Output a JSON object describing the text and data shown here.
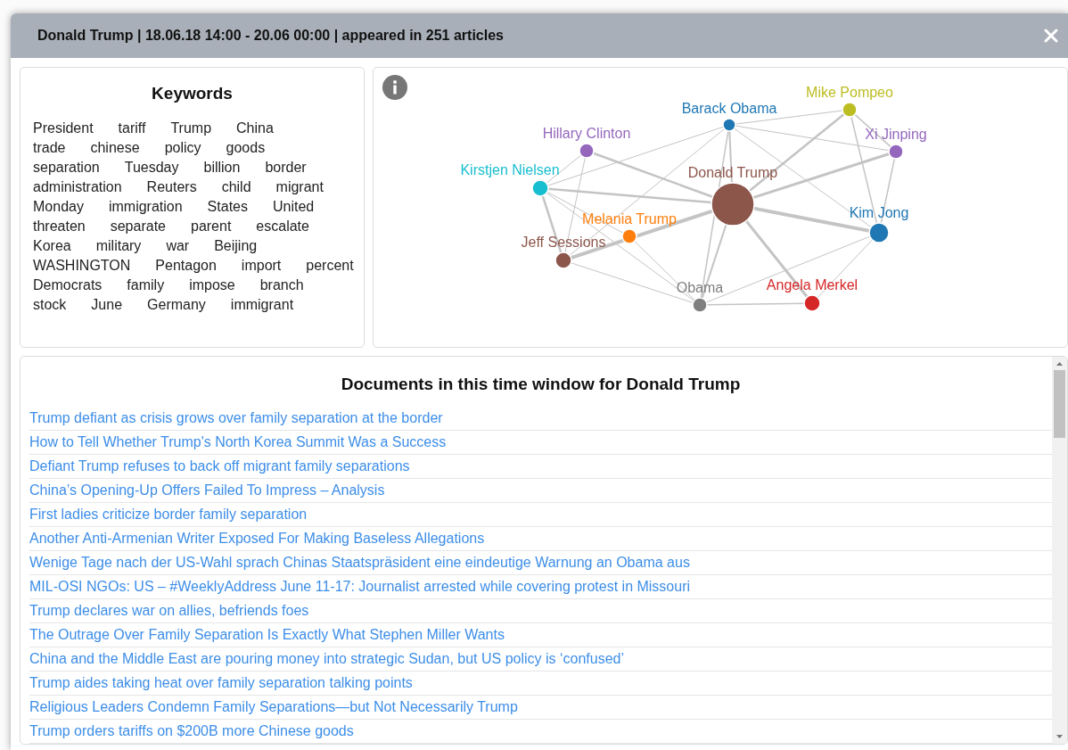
{
  "dialog": {
    "title": "Donald Trump | 18.06.18 14:00 - 20.06 00:00 | appeared in 251 articles"
  },
  "keywords": {
    "title": "Keywords",
    "words": [
      "President",
      "tariff",
      "Trump",
      "China",
      "trade",
      "chinese",
      "policy",
      "goods",
      "separation",
      "Tuesday",
      "billion",
      "border",
      "administration",
      "Reuters",
      "child",
      "migrant",
      "Monday",
      "immigration",
      "States",
      "United",
      "threaten",
      "separate",
      "parent",
      "escalate",
      "Korea",
      "military",
      "war",
      "Beijing",
      "WASHINGTON",
      "Pentagon",
      "import",
      "percent",
      "Democrats",
      "family",
      "impose",
      "branch",
      "stock",
      "June",
      "Germany",
      "immigrant"
    ]
  },
  "network": {
    "nodes": [
      {
        "name": "Barack Obama",
        "color": "#1f77b4"
      },
      {
        "name": "Mike Pompeo",
        "color": "#bcbd22"
      },
      {
        "name": "Hillary Clinton",
        "color": "#9467bd"
      },
      {
        "name": "Xi Jinping",
        "color": "#9467bd"
      },
      {
        "name": "Kirstjen Nielsen",
        "color": "#17becf"
      },
      {
        "name": "Donald Trump",
        "color": "#8c564b"
      },
      {
        "name": "Melania Trump",
        "color": "#ff7f0e"
      },
      {
        "name": "Kim Jong",
        "color": "#1f77b4"
      },
      {
        "name": "Jeff Sessions",
        "color": "#8c564b"
      },
      {
        "name": "Obama",
        "color": "#7f7f7f"
      },
      {
        "name": "Angela Merkel",
        "color": "#d62728"
      }
    ]
  },
  "documents": {
    "title": "Documents in this time window for Donald Trump",
    "items": [
      "Trump defiant as crisis grows over family separation at the border",
      "How to Tell Whether Trump's North Korea Summit Was a Success",
      "Defiant Trump refuses to back off migrant family separations",
      "China’s Opening-Up Offers Failed To Impress – Analysis",
      "First ladies criticize border family separation",
      "Another Anti-Armenian Writer Exposed For Making Baseless Allegations",
      "Wenige Tage nach der US-Wahl sprach Chinas Staatspräsident eine eindeutige Warnung an Obama aus",
      "MIL-OSI NGOs: US – #WeeklyAddress June 11-17: Journalist arrested while covering protest in Missouri",
      "Trump declares war on allies, befriends foes",
      "The Outrage Over Family Separation Is Exactly What Stephen Miller Wants",
      "China and the Middle East are pouring money into strategic Sudan, but US policy is ‘confused’",
      "Trump aides taking heat over family separation talking points",
      "Religious Leaders Condemn Family Separations—but Not Necessarily Trump",
      "Trump orders tariffs on $200B more Chinese goods"
    ]
  }
}
